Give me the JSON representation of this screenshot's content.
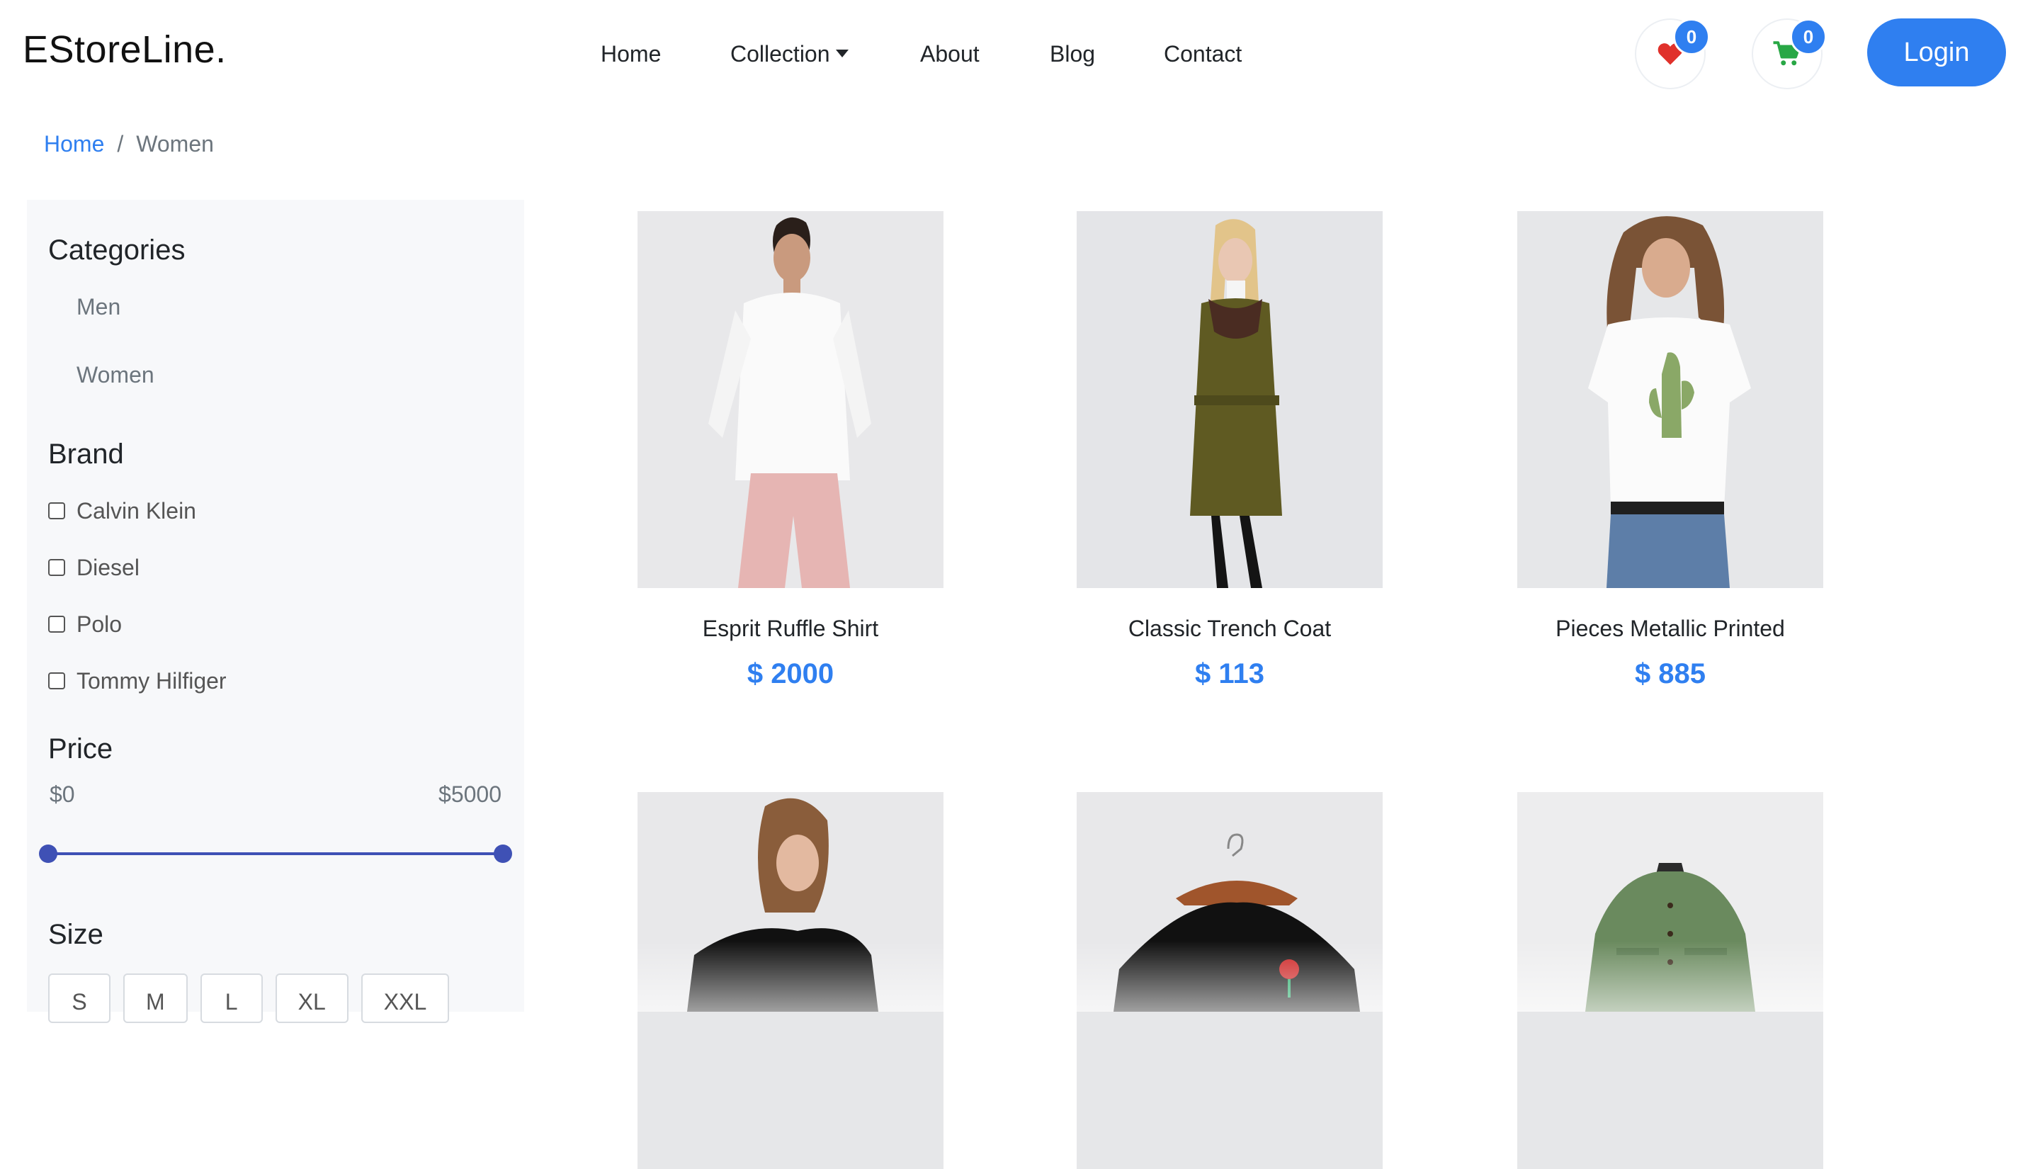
{
  "header": {
    "brand": "EStoreLine.",
    "nav": [
      "Home",
      "Collection",
      "About",
      "Blog",
      "Contact"
    ],
    "wishlist_count": "0",
    "cart_count": "0",
    "login_label": "Login",
    "wishlist_icon_color": "#e0312b",
    "cart_icon_color": "#28a745",
    "accent": "#2f7ff0"
  },
  "breadcrumb": {
    "home": "Home",
    "separator": "/",
    "current": "Women"
  },
  "sidebar": {
    "categories_title": "Categories",
    "categories": [
      "Men",
      "Women"
    ],
    "brand_title": "Brand",
    "brands": [
      "Calvin Klein",
      "Diesel",
      "Polo",
      "Tommy Hilfiger"
    ],
    "price_title": "Price",
    "price_min": "$0",
    "price_max": "$5000",
    "price_range_fraction": [
      0,
      1
    ],
    "size_title": "Size",
    "sizes": [
      "S",
      "M",
      "L",
      "XL",
      "XXL"
    ]
  },
  "products": [
    {
      "name": "Esprit Ruffle Shirt",
      "price": "$ 2000"
    },
    {
      "name": "Classic Trench Coat",
      "price": "$ 113"
    },
    {
      "name": "Pieces Metallic Printed",
      "price": "$ 885"
    },
    {
      "name": "",
      "price": ""
    },
    {
      "name": "",
      "price": ""
    },
    {
      "name": "",
      "price": ""
    }
  ]
}
